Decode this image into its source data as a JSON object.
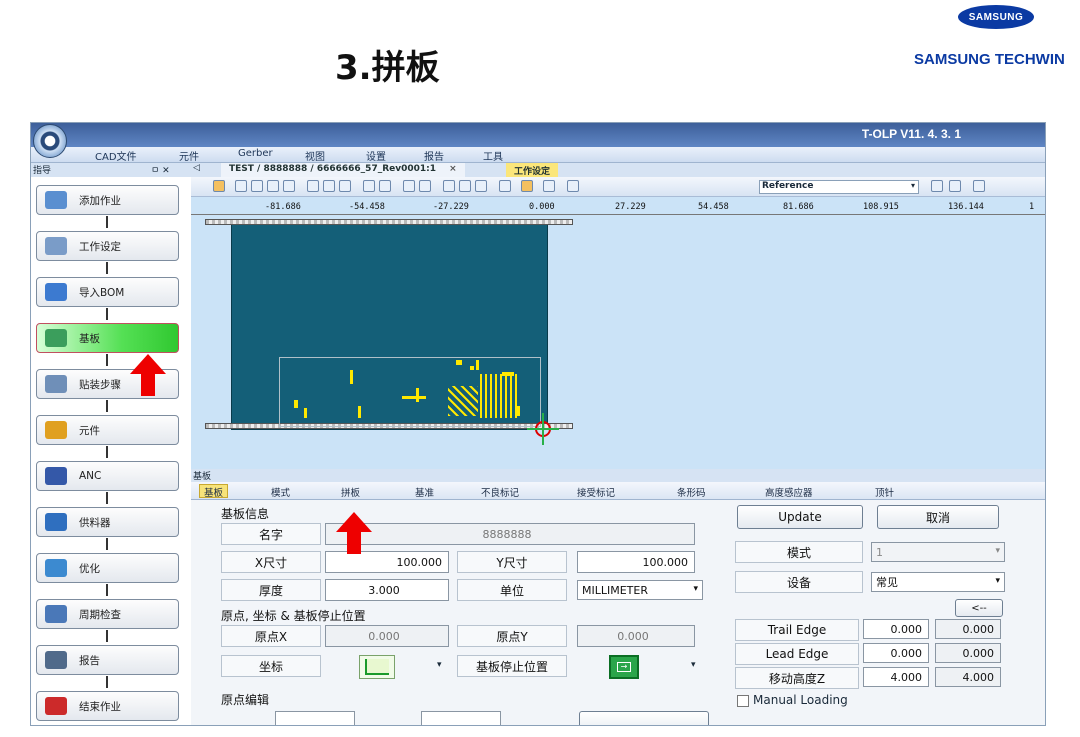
{
  "slide": {
    "title": "3.拼板",
    "brand_logo": "SAMSUNG",
    "brand_name": "SAMSUNG TECHWIN"
  },
  "app": {
    "title": "T-OLP V11. 4. 3. 1",
    "menu": [
      "CAD文件",
      "元件",
      "Gerber",
      "视图",
      "设置",
      "报告",
      "工具"
    ],
    "sidebar_header": "指导",
    "sidebar_pin": "ㅁ ✕",
    "doc_tab": "TEST / 8888888 / 6666666_57_Rev0001:1",
    "doc_tab_close": "×",
    "active_tab": "工作设定",
    "tab_prev": "◁",
    "reference_select": "Reference",
    "sidebar_items": [
      {
        "label": "添加作业",
        "icon": "add-job-icon",
        "color": "#5a8fd0"
      },
      {
        "label": "工作设定",
        "icon": "job-settings-icon",
        "color": "#7a9cc8"
      },
      {
        "label": "导入BOM",
        "icon": "import-bom-icon",
        "color": "#3c7ad0"
      },
      {
        "label": "基板",
        "icon": "board-icon",
        "color": "#3b9e5c"
      },
      {
        "label": "贴装步骤",
        "icon": "placement-step-icon",
        "color": "#6f8fb8"
      },
      {
        "label": "元件",
        "icon": "component-icon",
        "color": "#e0a020"
      },
      {
        "label": "ANC",
        "icon": "anc-icon",
        "color": "#3458a8"
      },
      {
        "label": "供料器",
        "icon": "feeder-icon",
        "color": "#2f6fbf"
      },
      {
        "label": "优化",
        "icon": "optimize-icon",
        "color": "#3c8ad0"
      },
      {
        "label": "周期检查",
        "icon": "cycle-check-icon",
        "color": "#4a78b8"
      },
      {
        "label": "报告",
        "icon": "report-icon",
        "color": "#506a8a"
      },
      {
        "label": "结束作业",
        "icon": "end-job-icon",
        "color": "#cc2a2a"
      }
    ],
    "ruler_ticks": [
      "-81.686",
      "-54.458",
      "-27.229",
      "0.000",
      "27.229",
      "54.458",
      "81.686",
      "108.915",
      "136.144",
      "1"
    ],
    "lower_header": "基板",
    "subtabs": [
      "基板",
      "模式",
      "拼板",
      "基准",
      "不良标记",
      "接受标记",
      "条形码",
      "高度感应器",
      "顶针"
    ],
    "board_info": {
      "group_title": "基板信息",
      "name_label": "名字",
      "name_value": "8888888",
      "x_label": "X尺寸",
      "x_value": "100.000",
      "y_label": "Y尺寸",
      "y_value": "100.000",
      "thick_label": "厚度",
      "thick_value": "3.000",
      "unit_label": "单位",
      "unit_value": "MILLIMETER"
    },
    "origin": {
      "group_title": "原点, 坐标 & 基板停止位置",
      "ox_label": "原点X",
      "ox_value": "0.000",
      "oy_label": "原点Y",
      "oy_value": "0.000",
      "coord_label": "坐标",
      "stop_label": "基板停止位置"
    },
    "origin_edit": {
      "group_title": "原点编辑"
    },
    "right_panel": {
      "update": "Update",
      "cancel": "取消",
      "mode_label": "模式",
      "mode_value": "1",
      "device_label": "设备",
      "device_value": "常见",
      "back_btn": "<--",
      "trail_label": "Trail Edge",
      "trail_v1": "0.000",
      "trail_v2": "0.000",
      "lead_label": "Lead Edge",
      "lead_v1": "0.000",
      "lead_v2": "0.000",
      "height_label": "移动高度Z",
      "height_v1": "4.000",
      "height_v2": "4.000",
      "manual_loading": "Manual Loading"
    }
  }
}
